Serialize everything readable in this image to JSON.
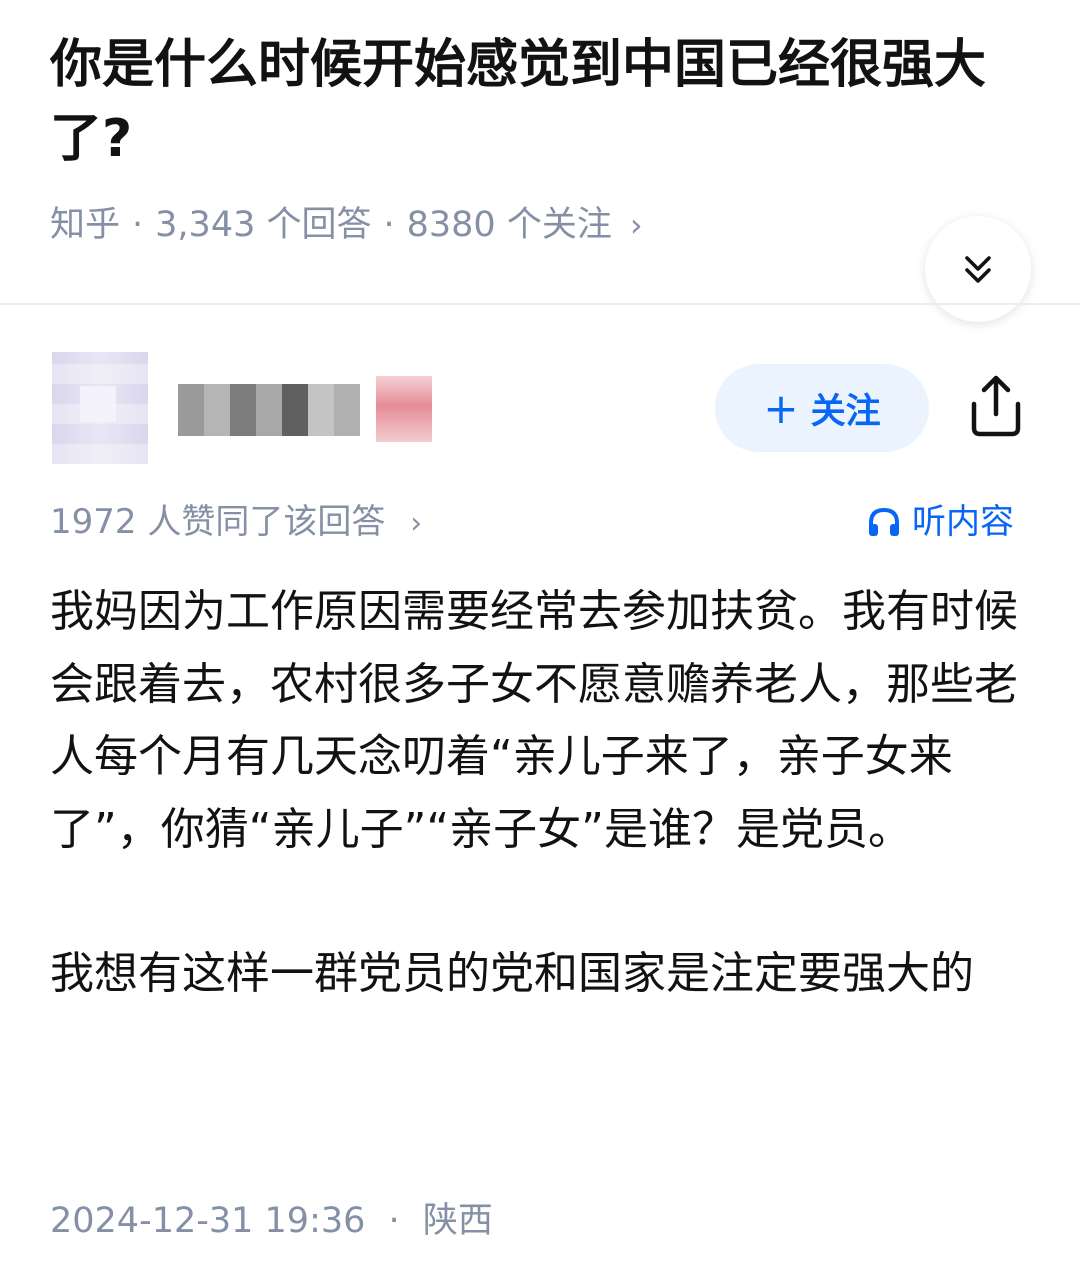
{
  "question": {
    "title": "你是什么时候开始感觉到中国已经很强大了?",
    "source": "知乎",
    "answers_count": "3,343 个回答",
    "followers_count": "8380 个关注"
  },
  "author": {
    "name": "",
    "follow_label": "关注"
  },
  "answer_meta": {
    "votes_text": "1972 人赞同了该回答",
    "listen_label": "听内容"
  },
  "answer": {
    "paragraphs": [
      "我妈因为工作原因需要经常去参加扶贫。我有时候会跟着去，农村很多子女不愿意赡养老人，那些老人每个月有几天念叨着“亲儿子来了，亲子女来了”，你猜“亲儿子”“亲子女”是谁？是党员。",
      "我想有这样一群党员的党和国家是注定要强大的"
    ],
    "date": "2024-12-31 19:36",
    "location": "陕西"
  },
  "icons": {
    "collapse": "double-chevron-down-icon",
    "share": "share-icon",
    "listen": "headphones-icon"
  },
  "colors": {
    "accent": "#0866f5",
    "follow_bg": "#ebf3ff",
    "meta_gray": "#8590a6",
    "text": "#121212"
  }
}
